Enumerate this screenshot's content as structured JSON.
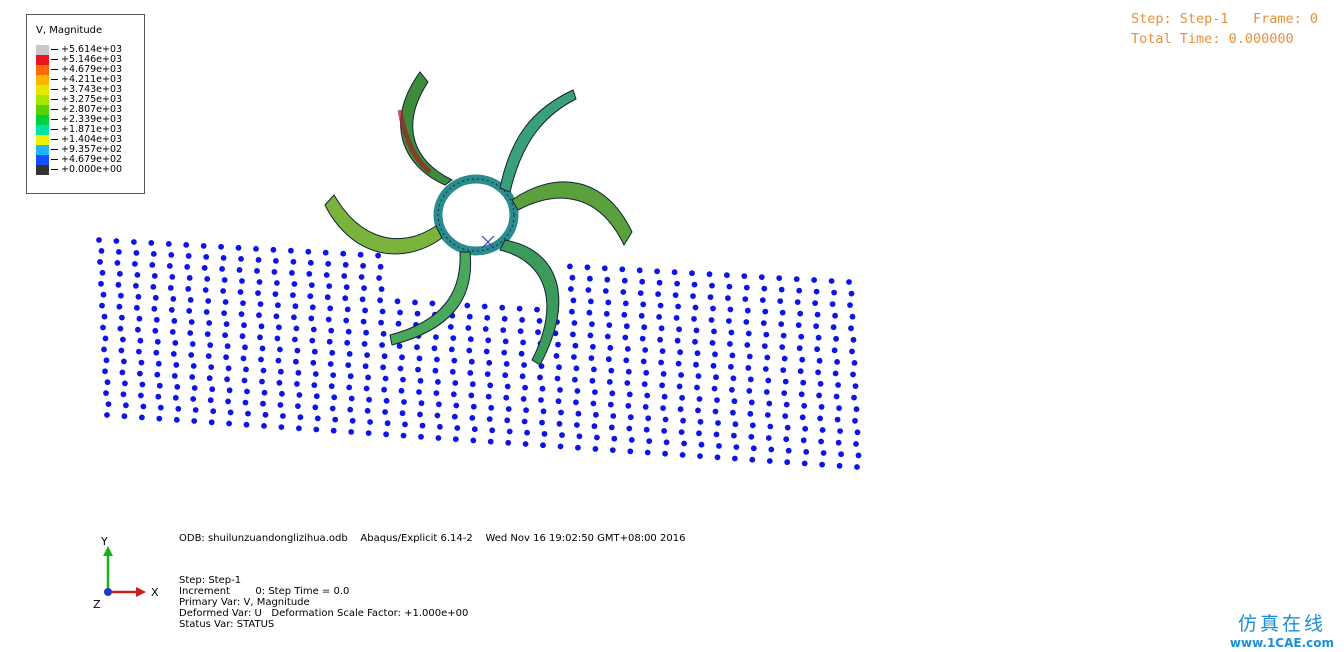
{
  "legend": {
    "title": "V, Magnitude",
    "entries": [
      {
        "label": "+5.614e+03",
        "color": "#c8c8c8"
      },
      {
        "label": "+5.146e+03",
        "color": "#e8141e"
      },
      {
        "label": "+4.679e+03",
        "color": "#ff6a00"
      },
      {
        "label": "+4.211e+03",
        "color": "#ffb400"
      },
      {
        "label": "+3.743e+03",
        "color": "#e6e600"
      },
      {
        "label": "+3.275e+03",
        "color": "#a8e600"
      },
      {
        "label": "+2.807e+03",
        "color": "#5ad200"
      },
      {
        "label": "+2.339e+03",
        "color": "#00d23c"
      },
      {
        "label": "+1.871e+03",
        "color": "#00e6a0"
      },
      {
        "label": "+1.404e+03",
        "color": "#f0f000"
      },
      {
        "label": "+9.357e+02",
        "color": "#1eb4ff"
      },
      {
        "label": "+4.679e+02",
        "color": "#1450ff"
      },
      {
        "label": "+0.000e+00",
        "color": "#0a14c8"
      }
    ],
    "bottom_color": "#333333"
  },
  "step_info": {
    "step": "Step: Step-1",
    "frame": "Frame: 0",
    "total_time": "Total Time: 0.000000"
  },
  "odb_line": "ODB: shuilunzuandonglizihua.odb    Abaqus/Explicit 6.14-2    Wed Nov 16 19:02:50 GMT+08:00 2016",
  "status": {
    "step": "Step: Step-1",
    "increment": "Increment        0: Step Time = 0.0",
    "primary_var": "Primary Var: V, Magnitude",
    "deformed_var": "Deformed Var: U   Deformation Scale Factor: +1.000e+00",
    "status_var": "Status Var: STATUS"
  },
  "triad": {
    "x": "X",
    "y": "Y",
    "z": "Z"
  },
  "watermark": {
    "cn": "仿真在线",
    "en": "www.1CAE.com"
  },
  "colors": {
    "particle": "#0f14e6",
    "step_text": "#e8903a",
    "blade_green": "#3c9a3c",
    "blade_teal": "#2a8c8c"
  }
}
